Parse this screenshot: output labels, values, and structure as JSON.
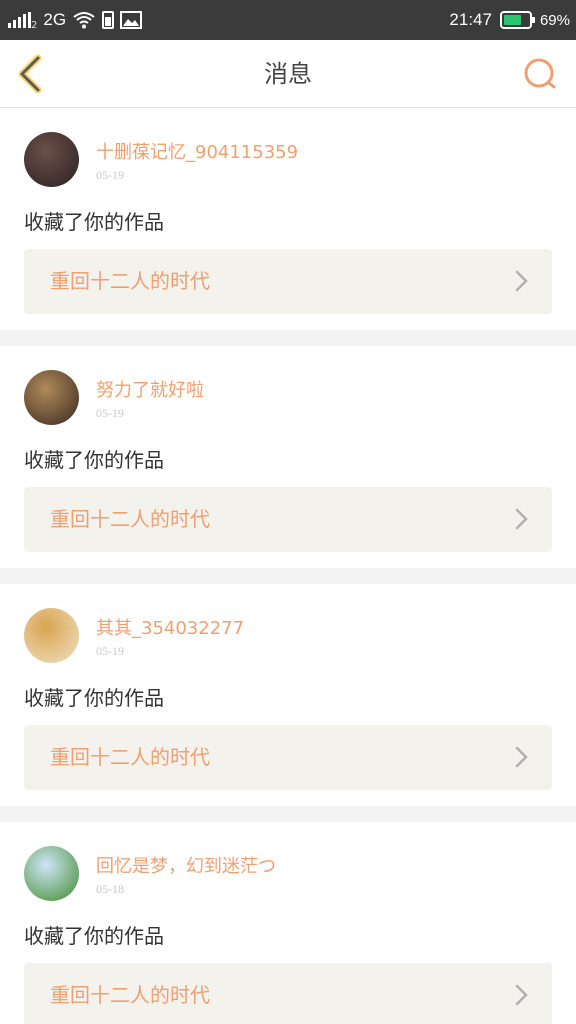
{
  "status_bar": {
    "network": "2G",
    "sim_slot": "2",
    "time": "21:47",
    "battery": "69%",
    "battery_level": 0.69,
    "battery_color": "#28c76f"
  },
  "header": {
    "title": "消息",
    "accent_color": "#f0a070",
    "back_icon": "chevron-left-icon",
    "search_icon": "search-icon"
  },
  "messages": [
    {
      "user": "十删葆记忆_904115359",
      "date": "05-19",
      "action": "收藏了你的作品",
      "work": "重回十二人的时代",
      "avatar_colors": [
        "#2a2024",
        "#6b5048"
      ]
    },
    {
      "user": "努力了就好啦",
      "date": "05-19",
      "action": "收藏了你的作品",
      "work": "重回十二人的时代",
      "avatar_colors": [
        "#3a2a20",
        "#b08a5a"
      ]
    },
    {
      "user": "其其_354032277",
      "date": "05-19",
      "action": "收藏了你的作品",
      "work": "重回十二人的时代",
      "avatar_colors": [
        "#efe2c4",
        "#d9a450"
      ]
    },
    {
      "user": "回忆是梦，幻到迷茫つ",
      "date": "05-18",
      "action": "收藏了你的作品",
      "work": "重回十二人的时代",
      "avatar_colors": [
        "#3f8a2e",
        "#cfe6f5"
      ]
    }
  ]
}
